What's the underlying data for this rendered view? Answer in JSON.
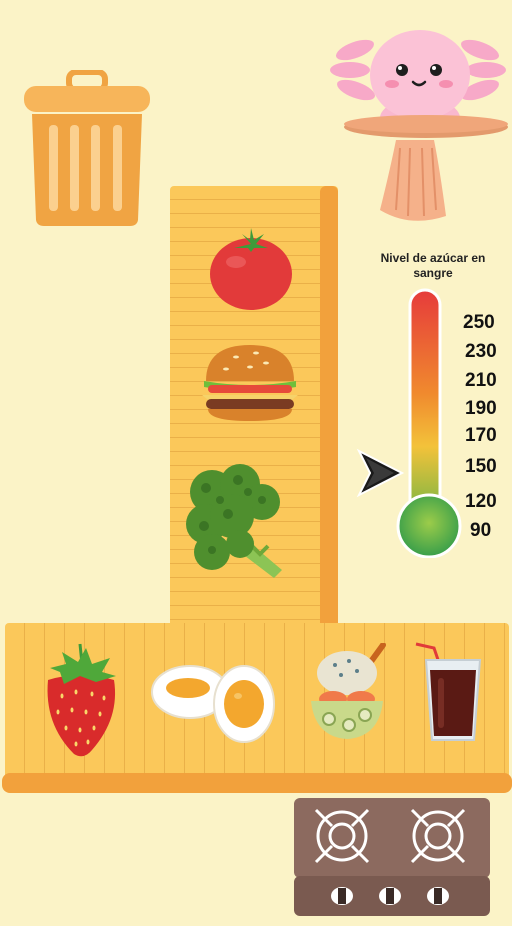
{
  "thermometer": {
    "title": "Nivel de azúcar en sangre",
    "ticks": [
      "250",
      "230",
      "210",
      "190",
      "170",
      "150",
      "120",
      "90"
    ],
    "colors": {
      "high": "#e63b3b",
      "mid": "#f5b93a",
      "low": "#3aa64a"
    },
    "current_level": 150
  },
  "vertical_tray": {
    "items": [
      "tomato-icon",
      "burger-icon",
      "broccoli-icon"
    ]
  },
  "horizontal_tray": {
    "items": [
      "strawberry-icon",
      "boiled-egg-icon",
      "salad-bowl-icon",
      "cola-glass-icon"
    ]
  },
  "colors": {
    "background": "#fbf3c7",
    "wood": "#fbc85a",
    "wood_rail": "#f2a13c",
    "trash": "#f0a443"
  }
}
